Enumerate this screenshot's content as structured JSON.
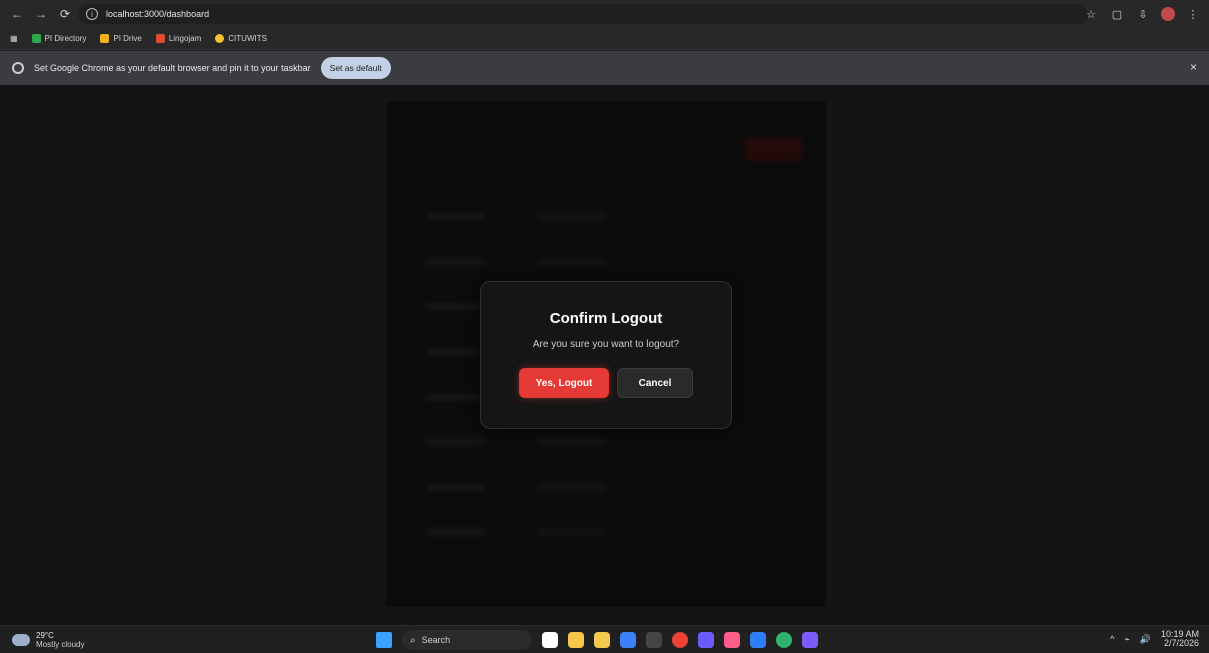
{
  "browser": {
    "url": "localhost:3000/dashboard",
    "bookmarks": [
      "PI Directory",
      "PI Drive",
      "Lingojam",
      "CITUWITS"
    ],
    "infobar": {
      "message": "Set Google Chrome as your default browser and pin it to your taskbar",
      "button": "Set as default",
      "close": "×"
    }
  },
  "modal": {
    "title": "Confirm Logout",
    "message": "Are you sure you want to logout?",
    "confirm": "Yes, Logout",
    "cancel": "Cancel"
  },
  "taskbar": {
    "weather_temp": "29°C",
    "weather_desc": "Mostly cloudy",
    "search_placeholder": "Search",
    "time": "10:19 AM",
    "date": "2/7/2026"
  },
  "colors": {
    "danger": "#e53935"
  }
}
